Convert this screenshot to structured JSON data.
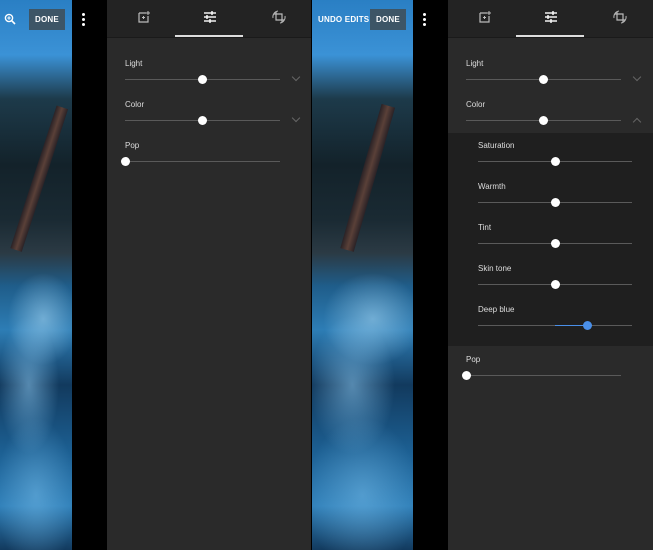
{
  "left": {
    "done_label": "DONE",
    "icons": {
      "zoom": "zoom-in-icon",
      "menu": "more-vertical-icon"
    },
    "tabs": [
      {
        "icon": "auto-enhance-icon"
      },
      {
        "icon": "adjust-sliders-icon",
        "active": true
      },
      {
        "icon": "crop-rotate-icon"
      }
    ],
    "sliders": [
      {
        "label": "Light",
        "value": 0.5,
        "chevron": "down"
      },
      {
        "label": "Color",
        "value": 0.5,
        "chevron": "down"
      },
      {
        "label": "Pop",
        "value": 0
      }
    ]
  },
  "right": {
    "undo_label": "UNDO EDITS",
    "done_label": "DONE",
    "icons": {
      "menu": "more-vertical-icon"
    },
    "tabs": [
      {
        "icon": "auto-enhance-icon"
      },
      {
        "icon": "adjust-sliders-icon",
        "active": true
      },
      {
        "icon": "crop-rotate-icon"
      }
    ],
    "sliders": [
      {
        "label": "Light",
        "value": 0.5,
        "chevron": "down"
      },
      {
        "label": "Color",
        "value": 0.5,
        "chevron": "up"
      }
    ],
    "color_sub": [
      {
        "label": "Saturation",
        "value": 0.5
      },
      {
        "label": "Warmth",
        "value": 0.5
      },
      {
        "label": "Tint",
        "value": 0.5
      },
      {
        "label": "Skin tone",
        "value": 0.5
      },
      {
        "label": "Deep blue",
        "value": 0.71,
        "active": true
      }
    ],
    "pop": {
      "label": "Pop",
      "value": 0
    }
  },
  "colors": {
    "accent": "#4a8fe8",
    "panel": "#2a2a2a",
    "header": "#232323",
    "done_bg": "#3d5566"
  }
}
